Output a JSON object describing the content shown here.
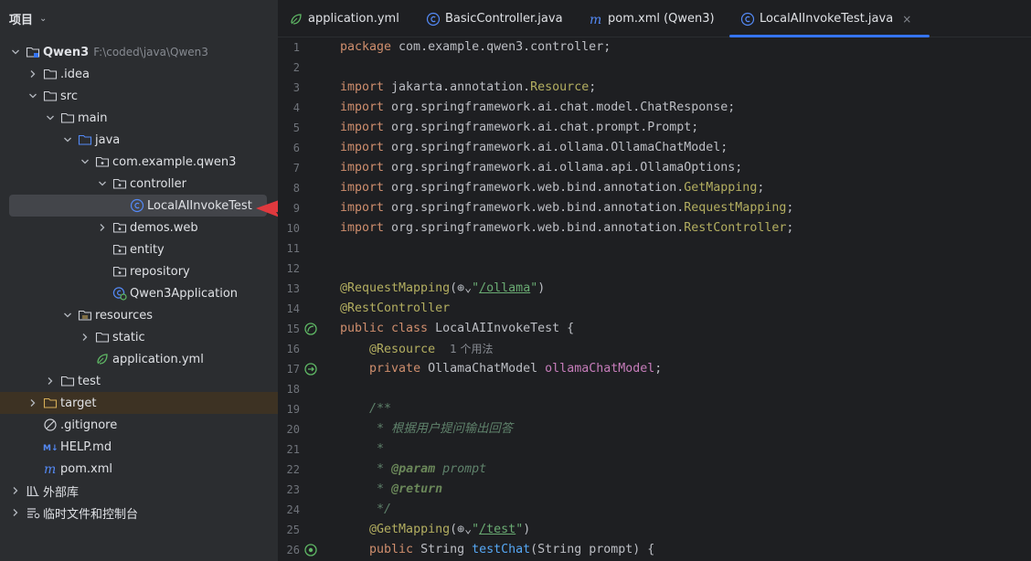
{
  "project_panel": {
    "title": "项目",
    "tree": [
      {
        "label": "Qwen3",
        "sub": "F:\\coded\\java\\Qwen3",
        "arrow": "down",
        "icon": "module-folder-icon",
        "depth": 0,
        "bold": true
      },
      {
        "label": ".idea",
        "arrow": "right",
        "icon": "folder-icon",
        "depth": 1
      },
      {
        "label": "src",
        "arrow": "down",
        "icon": "folder-icon",
        "depth": 1
      },
      {
        "label": "main",
        "arrow": "down",
        "icon": "folder-icon",
        "depth": 2
      },
      {
        "label": "java",
        "arrow": "down",
        "icon": "source-folder-icon",
        "depth": 3
      },
      {
        "label": "com.example.qwen3",
        "arrow": "down",
        "icon": "package-icon",
        "depth": 4
      },
      {
        "label": "controller",
        "arrow": "down",
        "icon": "package-icon",
        "depth": 5
      },
      {
        "label": "LocalAIInvokeTest",
        "arrow": "",
        "icon": "java-class-icon",
        "depth": 6,
        "selected": true
      },
      {
        "label": "demos.web",
        "arrow": "right",
        "icon": "package-icon",
        "depth": 5
      },
      {
        "label": "entity",
        "arrow": "",
        "icon": "package-icon",
        "depth": 5
      },
      {
        "label": "repository",
        "arrow": "",
        "icon": "package-icon",
        "depth": 5
      },
      {
        "label": "Qwen3Application",
        "arrow": "",
        "icon": "spring-boot-app-icon",
        "depth": 5
      },
      {
        "label": "resources",
        "arrow": "down",
        "icon": "resources-folder-icon",
        "depth": 3
      },
      {
        "label": "static",
        "arrow": "right",
        "icon": "folder-icon",
        "depth": 4
      },
      {
        "label": "application.yml",
        "arrow": "",
        "icon": "yaml-spring-icon",
        "depth": 4
      },
      {
        "label": "test",
        "arrow": "right",
        "icon": "folder-icon",
        "depth": 2
      },
      {
        "label": "target",
        "arrow": "right",
        "icon": "excluded-folder-icon",
        "depth": 1,
        "target": true
      },
      {
        "label": ".gitignore",
        "arrow": "",
        "icon": "gitignore-icon",
        "depth": 1
      },
      {
        "label": "HELP.md",
        "arrow": "",
        "icon": "markdown-icon",
        "depth": 1
      },
      {
        "label": "pom.xml",
        "arrow": "",
        "icon": "maven-icon",
        "depth": 1
      },
      {
        "label": "外部库",
        "arrow": "right",
        "icon": "library-icon",
        "depth": 0
      },
      {
        "label": "临时文件和控制台",
        "arrow": "right",
        "icon": "scratches-icon",
        "depth": 0
      }
    ]
  },
  "tabs": [
    {
      "label": "application.yml",
      "icon": "yaml-spring-icon"
    },
    {
      "label": "BasicController.java",
      "icon": "java-class-icon"
    },
    {
      "label": "pom.xml (Qwen3)",
      "icon": "maven-icon"
    },
    {
      "label": "LocalAIInvokeTest.java",
      "icon": "java-class-icon",
      "active": true,
      "close": "×"
    }
  ],
  "code_lines": [
    {
      "n": "1",
      "parts": [
        [
          "kw",
          "package "
        ],
        [
          "",
          "com.example.qwen3.controller;"
        ]
      ]
    },
    {
      "n": "2",
      "parts": []
    },
    {
      "n": "3",
      "parts": [
        [
          "kw",
          "import "
        ],
        [
          "",
          "jakarta.annotation."
        ],
        [
          "an",
          "Resource"
        ],
        [
          "",
          ";"
        ]
      ]
    },
    {
      "n": "4",
      "parts": [
        [
          "kw",
          "import "
        ],
        [
          "",
          "org.springframework.ai.chat.model.ChatResponse;"
        ]
      ]
    },
    {
      "n": "5",
      "parts": [
        [
          "kw",
          "import "
        ],
        [
          "",
          "org.springframework.ai.chat.prompt.Prompt;"
        ]
      ]
    },
    {
      "n": "6",
      "parts": [
        [
          "kw",
          "import "
        ],
        [
          "",
          "org.springframework.ai.ollama.OllamaChatModel;"
        ]
      ]
    },
    {
      "n": "7",
      "parts": [
        [
          "kw",
          "import "
        ],
        [
          "",
          "org.springframework.ai.ollama.api.OllamaOptions;"
        ]
      ]
    },
    {
      "n": "8",
      "parts": [
        [
          "kw",
          "import "
        ],
        [
          "",
          "org.springframework.web.bind.annotation."
        ],
        [
          "an",
          "GetMapping"
        ],
        [
          "",
          ";"
        ]
      ]
    },
    {
      "n": "9",
      "parts": [
        [
          "kw",
          "import "
        ],
        [
          "",
          "org.springframework.web.bind.annotation."
        ],
        [
          "an",
          "RequestMapping"
        ],
        [
          "",
          ";"
        ]
      ]
    },
    {
      "n": "10",
      "parts": [
        [
          "kw",
          "import "
        ],
        [
          "",
          "org.springframework.web.bind.annotation."
        ],
        [
          "an",
          "RestController"
        ],
        [
          "",
          ";"
        ]
      ]
    },
    {
      "n": "11",
      "parts": []
    },
    {
      "n": "12",
      "parts": []
    },
    {
      "n": "13",
      "parts": [
        [
          "an",
          "@RequestMapping"
        ],
        [
          "",
          "("
        ],
        [
          "globe",
          "⊕"
        ],
        [
          "",
          "⌄"
        ],
        [
          "st",
          "\""
        ],
        [
          "st lk",
          "/ollama"
        ],
        [
          "st",
          "\""
        ],
        [
          "",
          ")"
        ]
      ]
    },
    {
      "n": "14",
      "parts": [
        [
          "an",
          "@RestController"
        ]
      ]
    },
    {
      "n": "15",
      "gutter": "spring-bean-icon",
      "parts": [
        [
          "kw",
          "public class "
        ],
        [
          "",
          "LocalAIInvokeTest {"
        ]
      ]
    },
    {
      "n": "16",
      "parts": [
        [
          "",
          "    "
        ],
        [
          "an",
          "@Resource"
        ],
        [
          "",
          "  "
        ],
        [
          "hint",
          "1 个用法"
        ]
      ]
    },
    {
      "n": "17",
      "gutter": "autowired-icon",
      "parts": [
        [
          "",
          "    "
        ],
        [
          "kw",
          "private "
        ],
        [
          "",
          "OllamaChatModel "
        ],
        [
          "fld",
          "ollamaChatModel"
        ],
        [
          "",
          ";"
        ]
      ]
    },
    {
      "n": "18",
      "parts": []
    },
    {
      "n": "19",
      "parts": [
        [
          "",
          "    "
        ],
        [
          "cm",
          "/**"
        ]
      ]
    },
    {
      "n": "20",
      "parts": [
        [
          "",
          "    "
        ],
        [
          "cm",
          " * 根据用户提问输出回答"
        ]
      ]
    },
    {
      "n": "21",
      "parts": [
        [
          "",
          "    "
        ],
        [
          "cm",
          " *"
        ]
      ]
    },
    {
      "n": "22",
      "parts": [
        [
          "",
          "    "
        ],
        [
          "cm",
          " * "
        ],
        [
          "tg",
          "@param "
        ],
        [
          "cm",
          "prompt"
        ]
      ]
    },
    {
      "n": "23",
      "parts": [
        [
          "",
          "    "
        ],
        [
          "cm",
          " * "
        ],
        [
          "tg",
          "@return"
        ]
      ]
    },
    {
      "n": "24",
      "parts": [
        [
          "",
          "    "
        ],
        [
          "cm",
          " */"
        ]
      ]
    },
    {
      "n": "25",
      "parts": [
        [
          "",
          "    "
        ],
        [
          "an",
          "@GetMapping"
        ],
        [
          "",
          "("
        ],
        [
          "globe",
          "⊕"
        ],
        [
          "",
          "⌄"
        ],
        [
          "st",
          "\""
        ],
        [
          "st lk",
          "/test"
        ],
        [
          "st",
          "\""
        ],
        [
          "",
          ")"
        ]
      ]
    },
    {
      "n": "26",
      "gutter": "endpoint-icon",
      "parts": [
        [
          "",
          "    "
        ],
        [
          "kw",
          "public "
        ],
        [
          "",
          "String "
        ],
        [
          "fn",
          "testChat"
        ],
        [
          "",
          "(String prompt) {"
        ]
      ]
    }
  ]
}
